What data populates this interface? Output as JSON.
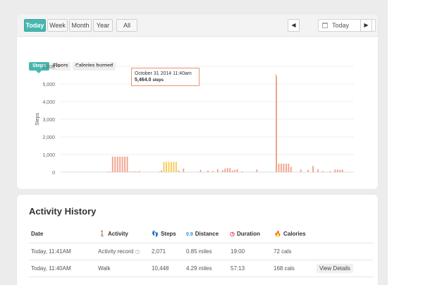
{
  "range_buttons": [
    "Today",
    "Week",
    "Month",
    "Year",
    "All"
  ],
  "date_picker": {
    "value": "Today",
    "prev_icon": "chevron-left-icon",
    "next_icon": "chevron-right-icon",
    "calendar_icon": "calendar-icon"
  },
  "metric_tabs": [
    "Steps",
    "Floors",
    "Calories burned"
  ],
  "chart_data": {
    "type": "bar",
    "ylabel": "Steps",
    "ylim": [
      0,
      6000
    ],
    "yticks": [
      "0",
      "1,000",
      "2,000",
      "3,000",
      "4,000",
      "5,000",
      "6,000"
    ],
    "grid": true,
    "colors": {
      "default": "#f2a48f",
      "highlight": "#f6cd5a",
      "peak": "#f0a07d"
    },
    "x": [
      "slot-19",
      "slot-20",
      "slot-21",
      "slot-22",
      "slot-23",
      "slot-24",
      "slot-25",
      "slot-26",
      "slot-27",
      "slot-28",
      "slot-29",
      "slot-30",
      "slot-31",
      "slot-32",
      "slot-40",
      "slot-41",
      "slot-42",
      "slot-43",
      "slot-44",
      "slot-45",
      "slot-46",
      "slot-47",
      "slot-48",
      "slot-50",
      "slot-57",
      "slot-60",
      "slot-62",
      "slot-64",
      "slot-66",
      "slot-67",
      "slot-68",
      "slot-69",
      "slot-70",
      "slot-71",
      "slot-72",
      "slot-74",
      "slot-80",
      "slot-88",
      "slot-89",
      "slot-90",
      "slot-91",
      "slot-92",
      "slot-93",
      "slot-94",
      "slot-98",
      "slot-101",
      "slot-103",
      "slot-105",
      "slot-107",
      "slot-110",
      "slot-112",
      "slot-113",
      "slot-114",
      "slot-115"
    ],
    "values": [
      30,
      30,
      880,
      880,
      880,
      880,
      880,
      880,
      880,
      30,
      30,
      50,
      30,
      60,
      30,
      100,
      580,
      580,
      580,
      580,
      580,
      580,
      100,
      200,
      130,
      80,
      60,
      180,
      110,
      200,
      230,
      230,
      100,
      130,
      170,
      40,
      150,
      5464,
      480,
      480,
      480,
      480,
      480,
      300,
      150,
      130,
      350,
      160,
      60,
      50,
      150,
      150,
      120,
      150
    ],
    "highlight_range": [
      16,
      21
    ],
    "tooltip": {
      "time": "October 31 2014 11:40am",
      "value": "5,464.0",
      "unit": "steps"
    }
  },
  "activity_history": {
    "title": "Activity History",
    "columns": [
      {
        "label": "Date",
        "icon": ""
      },
      {
        "label": "Activity",
        "icon": "walking-person-icon",
        "color": "#2bb3a3"
      },
      {
        "label": "Steps",
        "icon": "footsteps-icon",
        "color": "#e0445a"
      },
      {
        "label": "Distance",
        "icon": "distance-dots-icon",
        "color": "#2a8fd6"
      },
      {
        "label": "Duration",
        "icon": "stopwatch-icon",
        "color": "#e0445a"
      },
      {
        "label": "Calories",
        "icon": "flame-icon",
        "color": "#f3a52c"
      }
    ],
    "rows": [
      {
        "date": "Today, 11:41AM",
        "activity": "Activity record",
        "steps": "2,071",
        "distance": "0.85 miles",
        "duration": "19:00",
        "calories": "72 cals",
        "action": ""
      },
      {
        "date": "Today, 11:40AM",
        "activity": "Walk",
        "steps": "10,448",
        "distance": "4.29 miles",
        "duration": "57:13",
        "calories": "168 cals",
        "action": "View Details"
      }
    ]
  }
}
